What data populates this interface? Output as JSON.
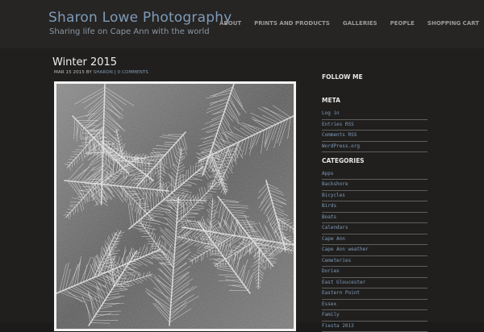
{
  "site": {
    "title": "Sharon Lowe Photography",
    "tagline": "Sharing life on Cape Ann with the world"
  },
  "nav": [
    "ABOUT",
    "PRINTS AND PRODUCTS",
    "GALLERIES",
    "PEOPLE",
    "SHOPPING CART"
  ],
  "post": {
    "title": "Winter 2015",
    "date": "MAR 15 2015",
    "by": "BY",
    "author": "SHARON",
    "separator": "|",
    "comments": "0 COMMENTS"
  },
  "sidebar": {
    "follow_title": "FOLLOW ME",
    "meta_title": "META",
    "meta_items": [
      "Log in",
      "Entries RSS",
      "Comments RSS",
      "WordPress.org"
    ],
    "categories_title": "CATEGORIES",
    "categories": [
      "Apps",
      "Backshore",
      "Bicycles",
      "Birds",
      "Boats",
      "Calendars",
      "Cape Ann",
      "Cape Ann weather",
      "Cemeteries",
      "Dories",
      "East Gloucester",
      "Eastern Point",
      "Essex",
      "Family",
      "Fiesta 2013"
    ]
  }
}
